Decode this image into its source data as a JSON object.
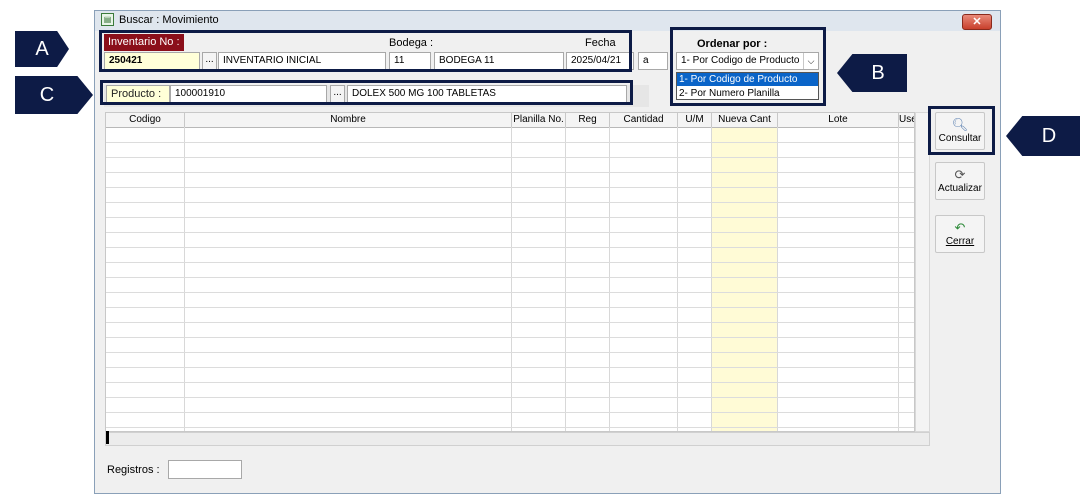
{
  "window": {
    "title": "Buscar : Movimiento",
    "close_glyph": "✕"
  },
  "header": {
    "inventario_label": "Inventario No  :",
    "inventario_no": "250421",
    "inventario_desc": "INVENTARIO INICIAL",
    "bodega_label": "Bodega :",
    "bodega_code": "11",
    "bodega_name": "BODEGA 11",
    "fecha_label": "Fecha",
    "fecha_value": "2025/04/21",
    "fecha_a": "a",
    "ellipsis": "..."
  },
  "ordenar": {
    "label": "Ordenar por :",
    "selected": "1- Por Codigo de Producto",
    "options": [
      "1- Por Codigo de Producto",
      "2- Por  Numero  Planilla"
    ]
  },
  "producto": {
    "label": "Producto :",
    "code": "100001910",
    "name": "DOLEX 500 MG 100 TABLETAS",
    "ellipsis": "..."
  },
  "grid": {
    "columns": [
      "Codigo",
      "Nombre",
      "Planilla No.",
      "Reg",
      "Cantidad",
      "U/M",
      "Nueva Cant",
      "Lote",
      "Use"
    ],
    "highlight_color": "#fffbd6"
  },
  "side_buttons": [
    {
      "label": "Consultar",
      "icon": "magnifier-icon"
    },
    {
      "label": "Actualizar",
      "icon": "refresh-icon"
    },
    {
      "label": "Cerrar",
      "icon": "return-arrow-icon"
    }
  ],
  "footer": {
    "registros_label": "Registros :",
    "registros_value": ""
  },
  "callouts": [
    "A",
    "B",
    "C",
    "D"
  ],
  "colors": {
    "callout": "#0d1b46",
    "label_red": "#8b0f1a",
    "field_yellow": "#ffffd8"
  }
}
